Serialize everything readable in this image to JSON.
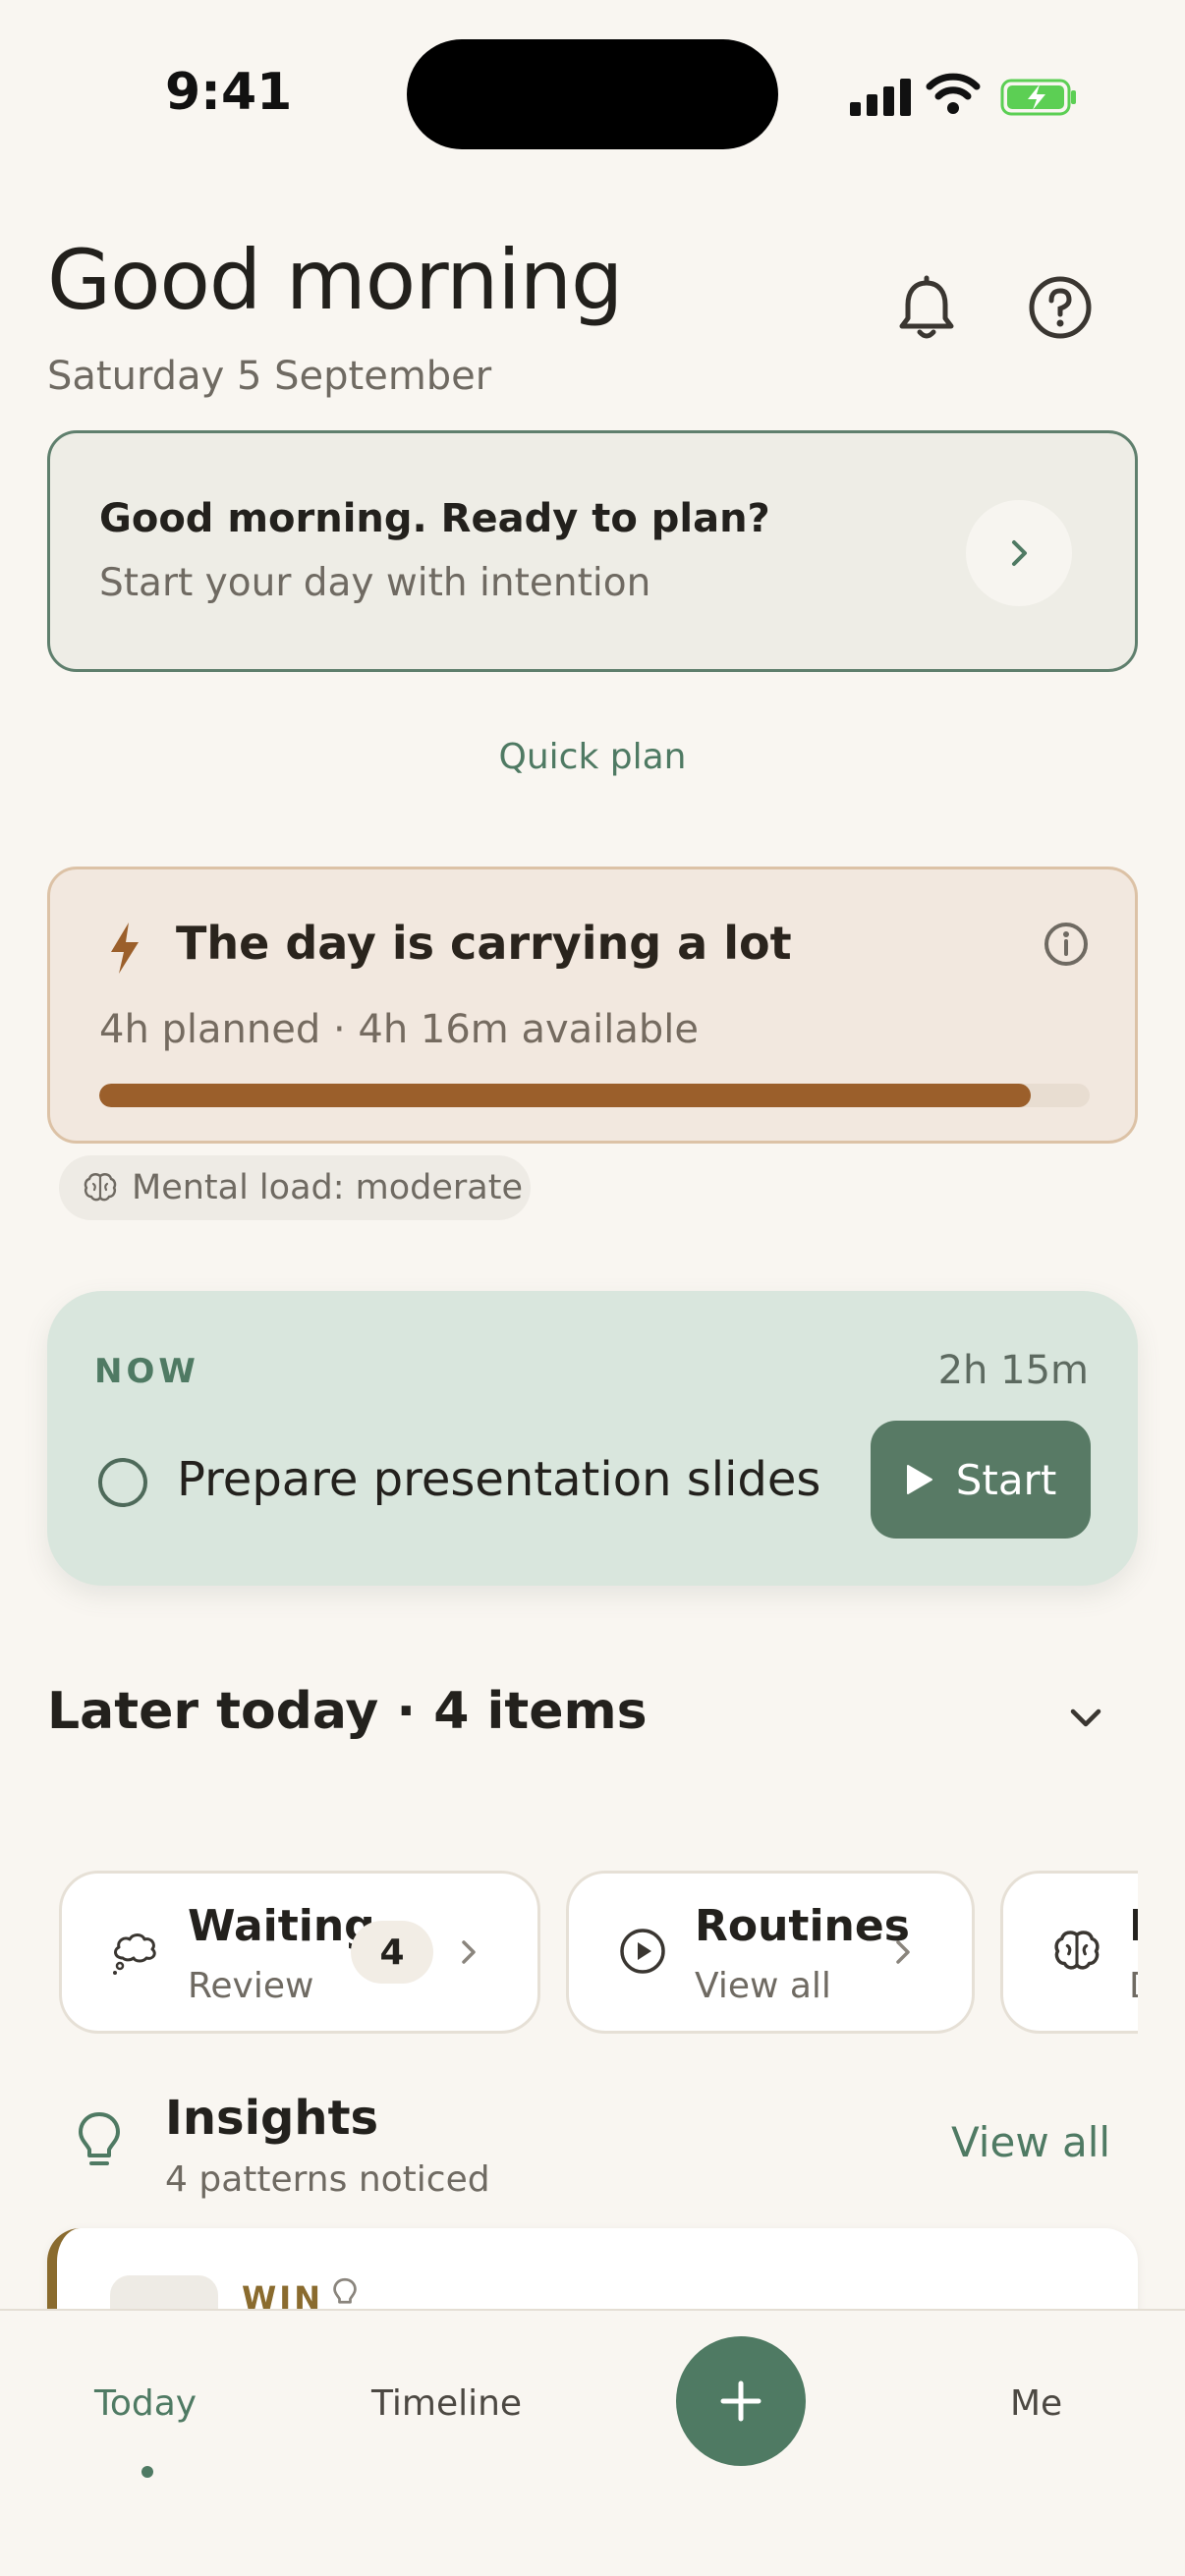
{
  "status_bar": {
    "time": "9:41"
  },
  "header": {
    "greeting": "Good morning",
    "date": "Saturday 5 September"
  },
  "plan_card": {
    "title": "Good morning. Ready to plan?",
    "subtitle": "Start your day with intention"
  },
  "quick_plan_label": "Quick plan",
  "load_card": {
    "title": "The day is carrying a lot",
    "summary": "4h planned · 4h 16m available",
    "progress_fraction": 0.94,
    "colors": {
      "fill": "#9b5f2b",
      "track": "#e8ddd1"
    }
  },
  "mental_load": {
    "label": "Mental load: moderate"
  },
  "now_card": {
    "label": "NOW",
    "duration": "2h 15m",
    "task": "Prepare presentation slides",
    "start_label": "Start"
  },
  "later_today": {
    "label": "Later today · 4 items"
  },
  "quick_chips": [
    {
      "title": "Waiting",
      "subtitle": "Review",
      "count": "4",
      "icon": "thought-cloud-icon"
    },
    {
      "title": "Routines",
      "subtitle": "View all",
      "icon": "play-circle-icon"
    },
    {
      "title": "L",
      "subtitle": "D",
      "icon": "brain-icon"
    }
  ],
  "insights": {
    "title": "Insights",
    "subtitle": "4 patterns noticed",
    "view_all": "View all",
    "first_card_label": "WIN"
  },
  "bottom_nav": {
    "items": [
      {
        "label": "Today",
        "active": true
      },
      {
        "label": "Timeline",
        "active": false
      },
      {
        "label": "Me",
        "active": false
      }
    ],
    "fab_icon": "plus-icon"
  },
  "colors": {
    "accent": "#4f7a63",
    "background": "#f9f6f1",
    "now_card": "#d9e6dd"
  }
}
